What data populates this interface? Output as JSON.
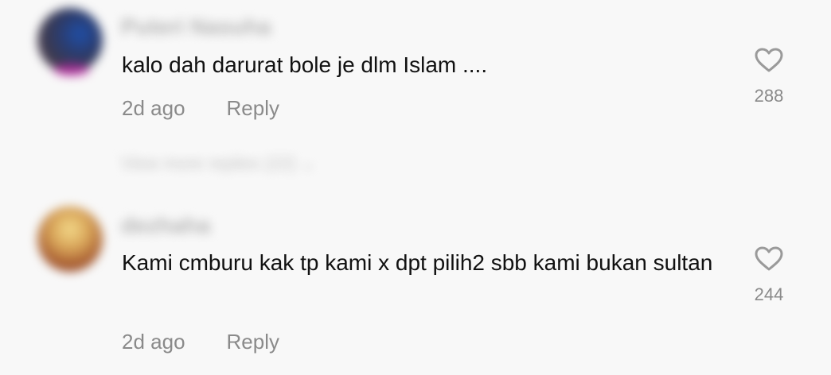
{
  "comments": [
    {
      "username": "Puteri Nasuha",
      "text": "kalo dah darurat bole je dlm Islam ....",
      "time": "2d ago",
      "reply_label": "Reply",
      "likes": "288"
    },
    {
      "username": "dezhaha",
      "text": "Kami cmburu kak tp kami x dpt pilih2 sbb kami bukan sultan",
      "time": "2d ago",
      "reply_label": "Reply",
      "likes": "244"
    }
  ],
  "view_replies_label": "View more replies (22)",
  "icons": {
    "like": "heart-icon",
    "expand": "chevron-down-icon"
  }
}
